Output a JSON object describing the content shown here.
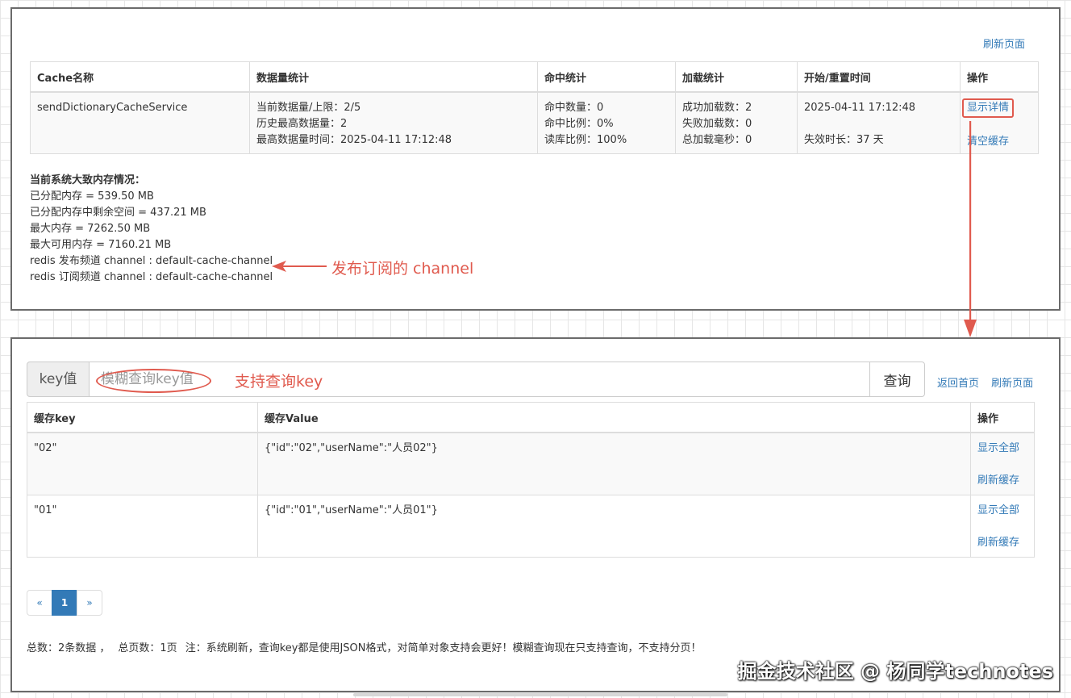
{
  "top_panel": {
    "refresh_link": "刷新页面",
    "table": {
      "headers": [
        "Cache名称",
        "数据量统计",
        "命中统计",
        "加载统计",
        "开始/重置时间",
        "操作"
      ],
      "row": {
        "name": "sendDictionaryCacheService",
        "data_stats": [
          "当前数据量/上限：2/5",
          "历史最高数据量：2",
          "最高数据量时间：2025-04-11 17:12:48"
        ],
        "hit_stats": [
          "命中数量：0",
          "命中比例：0%",
          "读库比例：100%"
        ],
        "load_stats": [
          "成功加载数：2",
          "失败加载数：0",
          "总加载毫秒：0"
        ],
        "start_time": "2025-04-11 17:12:48",
        "expire": "失效时长：37 天",
        "ops": {
          "detail": "显示详情",
          "clear": "清空缓存"
        }
      }
    },
    "memory": {
      "title": "当前系统大致内存情况：",
      "lines": [
        "已分配内存 = 539.50 MB",
        "已分配内存中剩余空间 = 437.21 MB",
        "最大内存 = 7262.50 MB",
        "最大可用内存 = 7160.21 MB",
        "redis 发布频道 channel : default-cache-channel",
        "redis 订阅频道 channel : default-cache-channel"
      ]
    },
    "annotation_channel": "发布订阅的 channel"
  },
  "bottom_panel": {
    "search": {
      "addon": "key值",
      "placeholder": "模糊查询key值",
      "button": "查询"
    },
    "annotation_key": "支持查询key",
    "nav": {
      "home": "返回首页",
      "refresh": "刷新页面"
    },
    "table": {
      "headers": [
        "缓存key",
        "缓存Value",
        "操作"
      ],
      "rows": [
        {
          "key": "\"02\"",
          "value": "{\"id\":\"02\",\"userName\":\"人员02\"}",
          "op_show": "显示全部",
          "op_refresh": "刷新缓存"
        },
        {
          "key": "\"01\"",
          "value": "{\"id\":\"01\",\"userName\":\"人员01\"}",
          "op_show": "显示全部",
          "op_refresh": "刷新缓存"
        }
      ]
    },
    "pager": {
      "prev": "«",
      "current": "1",
      "next": "»"
    },
    "footer": {
      "total": "总数：2条数据 ，",
      "pages": "总页数：1页",
      "note": "注：系统刷新，查询key都是使用JSON格式，对简单对象支持会更好！模糊查询现在只支持查询，不支持分页！"
    }
  },
  "watermark": "掘金技术社区 @ 杨同学technotes",
  "colors": {
    "link": "#337ab7",
    "annotation": "#e05a4e",
    "panel_border": "#6b6b6b"
  }
}
